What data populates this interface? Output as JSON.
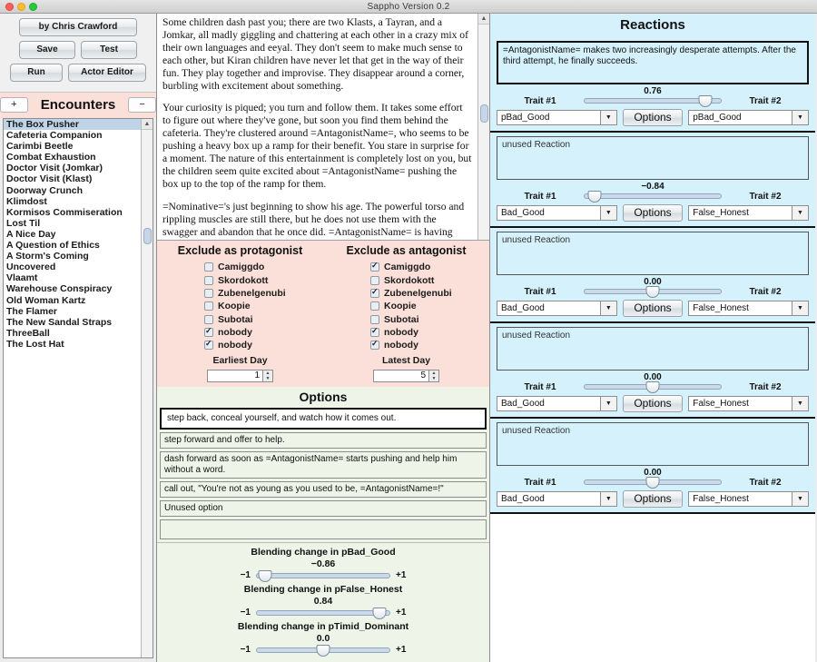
{
  "window": {
    "title": "Sappho Version 0.2"
  },
  "toolbar": {
    "credit_label": "by Chris Crawford",
    "save_label": "Save",
    "test_label": "Test",
    "run_label": "Run",
    "actor_editor_label": "Actor Editor"
  },
  "encounters": {
    "add_label": "+",
    "remove_label": "−",
    "title": "Encounters",
    "selected": "The Box Pusher",
    "items": [
      "The Box Pusher",
      "Cafeteria Companion",
      "Carimbi Beetle",
      "Combat Exhaustion",
      "Doctor Visit (Jomkar)",
      "Doctor Visit (Klast)",
      "Doorway Crunch",
      "Klimdost",
      "Kormisos Commiseration",
      "Lost Til",
      "A Nice Day",
      "A Question of Ethics",
      "A Storm's Coming",
      "Uncovered",
      "Vlaamt",
      "Warehouse Conspiracy",
      "Old Woman Kartz",
      "The Flamer",
      "The New Sandal Straps",
      "ThreeBall",
      "The Lost Hat"
    ]
  },
  "story": {
    "paragraphs": [
      "Some children dash past you; there are two Klasts, a Tayran, and a Jomkar, all madly giggling and chattering at each other in a crazy mix of their own languages and eeyal.  They don't seem to make much sense to each other, but Kiran children have never let that get in the way of their fun.  They play together and improvise.  They disappear around a corner, burbling with excitement about something.",
      "Your curiosity is piqued; you turn and follow them.  It takes some effort to figure out where they've gone, but soon you find them behind the cafeteria.  They're clustered around =AntagonistName=, who seems to be pushing a heavy box up a ramp for their benefit.  You stare in surprise for a moment. The nature of this entertainment is completely lost on you, but the children seem quite excited about =AntagonistName= pushing the box up to the top of the ramp for them.",
      "=Nominative='s just beginning to show his age.  The powerful torso and rippling muscles are still there, but he does not use them with the swagger and abandon that he once did. =AntagonistName= is having trouble getting the box up the ramp.  He puffs and grunts and shoves; the heavy box slides up the ramp almost to the top.  Once there, though, he cannot get the leverage he needs to move it the last remaining distance."
    ]
  },
  "exclude": {
    "protagonist_header": "Exclude as protagonist",
    "antagonist_header": "Exclude as antagonist",
    "protagonist": [
      {
        "label": "Camiggdo",
        "checked": false
      },
      {
        "label": "Skordokott",
        "checked": false
      },
      {
        "label": "Zubenelgenubi",
        "checked": false
      },
      {
        "label": "Koopie",
        "checked": false
      },
      {
        "label": "Subotai",
        "checked": false
      },
      {
        "label": "nobody",
        "checked": true
      },
      {
        "label": "nobody",
        "checked": true
      }
    ],
    "antagonist": [
      {
        "label": "Camiggdo",
        "checked": true
      },
      {
        "label": "Skordokott",
        "checked": false
      },
      {
        "label": "Zubenelgenubi",
        "checked": true
      },
      {
        "label": "Koopie",
        "checked": false
      },
      {
        "label": "Subotai",
        "checked": false
      },
      {
        "label": "nobody",
        "checked": true
      },
      {
        "label": "nobody",
        "checked": true
      }
    ],
    "earliest_day_label": "Earliest Day",
    "earliest_day_value": "1",
    "latest_day_label": "Latest Day",
    "latest_day_value": "5"
  },
  "options": {
    "header": "Options",
    "items": [
      {
        "text": "step back, conceal yourself, and watch how it comes out.",
        "selected": true
      },
      {
        "text": "step forward and offer to help.",
        "selected": false
      },
      {
        "text": "dash forward as soon as =AntagonistName= starts pushing and help him without a word.",
        "selected": false
      },
      {
        "text": "call out, \"You're not as young as you used to be, =AntagonistName=!\"",
        "selected": false
      },
      {
        "text": "Unused option",
        "selected": false
      },
      {
        "text": "",
        "selected": false
      }
    ]
  },
  "blending": {
    "min_label": "−1",
    "max_label": "+1",
    "sliders": [
      {
        "title": "Blending change in pBad_Good",
        "value": "−0.86",
        "pos": 0.07
      },
      {
        "title": "Blending change in pFalse_Honest",
        "value": "0.84",
        "pos": 0.92
      },
      {
        "title": "Blending change in pTimid_Dominant",
        "value": "0.0",
        "pos": 0.5
      }
    ]
  },
  "reactions": {
    "title": "Reactions",
    "trait1_label": "Trait #1",
    "trait2_label": "Trait #2",
    "options_label": "Options",
    "items": [
      {
        "text": "=AntagonistName= makes two increasingly desperate attempts. After the third attempt, he finally succeeds.",
        "used": true,
        "value": "0.76",
        "pos": 0.88,
        "trait1": "pBad_Good",
        "trait2": "pBad_Good"
      },
      {
        "text": "unused Reaction",
        "used": false,
        "value": "−0.84",
        "pos": 0.08,
        "trait1": "Bad_Good",
        "trait2": "False_Honest"
      },
      {
        "text": "unused Reaction",
        "used": false,
        "value": "0.00",
        "pos": 0.5,
        "trait1": "Bad_Good",
        "trait2": "False_Honest"
      },
      {
        "text": "unused Reaction",
        "used": false,
        "value": "0.00",
        "pos": 0.5,
        "trait1": "Bad_Good",
        "trait2": "False_Honest"
      },
      {
        "text": "unused Reaction",
        "used": false,
        "value": "0.00",
        "pos": 0.5,
        "trait1": "Bad_Good",
        "trait2": "False_Honest"
      }
    ]
  },
  "colors": {
    "reactions_bg": "#d5f2fc",
    "exclude_bg": "#fbe0da",
    "options_bg": "#eef4e8",
    "selection": "#bfd4e8"
  }
}
